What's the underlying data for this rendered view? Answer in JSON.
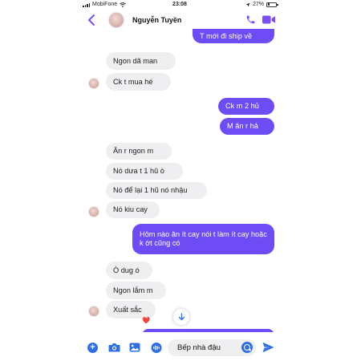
{
  "status_bar": {
    "carrier": "MobiFone",
    "time": "23:08",
    "battery_percent": "27%",
    "battery_level": 0.27
  },
  "header": {
    "contact_name": "Nguyễn Tuyền",
    "icons": [
      "back-icon",
      "avatar",
      "call-icon",
      "video-icon"
    ]
  },
  "messages": [
    {
      "dir": "out",
      "text": "T mới đi ship về"
    },
    {
      "dir": "in",
      "text": "Ngon dã man"
    },
    {
      "dir": "in",
      "text": "Ck t mua hé"
    },
    {
      "dir": "out",
      "text": "Ck m 2 hủ"
    },
    {
      "dir": "out",
      "text": "M ăn r hả"
    },
    {
      "dir": "in",
      "text": "Ăn r ngon m"
    },
    {
      "dir": "in",
      "text": "Nó dưa t 1 hũ ò"
    },
    {
      "dir": "in",
      "text": "Nó để lại 1 hũ nó nhậu"
    },
    {
      "dir": "in",
      "text": "Nó kiu cay"
    },
    {
      "dir": "out",
      "text": "Hôm nào ăn ít cay nói t làm ít cay hoặc k ớt cũng có"
    },
    {
      "dir": "in",
      "text": "Ò dug ó"
    },
    {
      "dir": "in",
      "text": "Ngon lắm m"
    },
    {
      "dir": "in",
      "text": "Xuất sắc",
      "reaction": "❤️"
    }
  ],
  "composer": {
    "input_value": "Bếp nhà đậu",
    "icons": [
      "plus-icon",
      "camera-icon",
      "gallery-icon",
      "mic-icon",
      "emoji-icon",
      "send-icon"
    ]
  },
  "colors": {
    "outgoing_bubble": "#6e4cf5",
    "incoming_bubble": "#efeff1",
    "accent": "#7a4ff7",
    "composer_icon": "#2f6fe4"
  }
}
